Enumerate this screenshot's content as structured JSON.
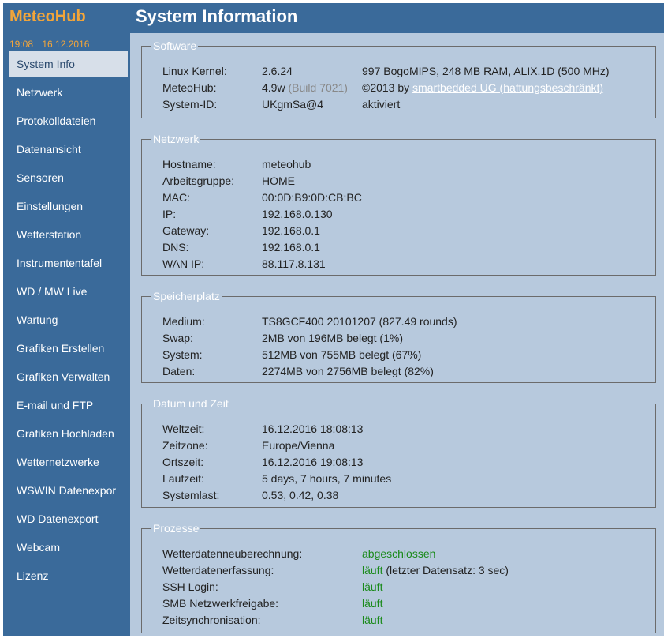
{
  "app": {
    "logo": "MeteoHub",
    "time": "19:08",
    "date": "16.12.2016"
  },
  "nav": [
    {
      "label": "System Info",
      "active": true
    },
    {
      "label": "Netzwerk"
    },
    {
      "label": "Protokolldateien"
    },
    {
      "label": "Datenansicht"
    },
    {
      "label": "Sensoren"
    },
    {
      "label": "Einstellungen"
    },
    {
      "label": "Wetterstation"
    },
    {
      "label": "Instrumententafel"
    },
    {
      "label": "WD / MW Live"
    },
    {
      "label": "Wartung"
    },
    {
      "label": "Grafiken Erstellen"
    },
    {
      "label": "Grafiken Verwalten"
    },
    {
      "label": "E-mail und FTP"
    },
    {
      "label": "Grafiken Hochladen"
    },
    {
      "label": "Wetternetzwerke"
    },
    {
      "label": "WSWIN Datenexpor"
    },
    {
      "label": "WD Datenexport"
    },
    {
      "label": "Webcam"
    },
    {
      "label": "Lizenz"
    }
  ],
  "page_title": "System Information",
  "software": {
    "legend": "Software",
    "kernel_label": "Linux Kernel:",
    "kernel_value": "2.6.24",
    "kernel_info": "997 BogoMIPS, 248 MB RAM, ALIX.1D (500 MHz)",
    "meteohub_label": "MeteoHub:",
    "meteohub_version": "4.9w",
    "meteohub_build": "(Build 7021)",
    "copyright_prefix": "©2013 by",
    "copyright_link": "smartbedded UG (haftungsbeschränkt)",
    "sysid_label": "System-ID:",
    "sysid_value": "UKgmSa@4",
    "sysid_status": "aktiviert"
  },
  "network": {
    "legend": "Netzwerk",
    "rows": [
      {
        "label": "Hostname:",
        "value": "meteohub"
      },
      {
        "label": "Arbeitsgruppe:",
        "value": "HOME"
      },
      {
        "label": "MAC:",
        "value": "00:0D:B9:0D:CB:BC"
      },
      {
        "label": "IP:",
        "value": "192.168.0.130"
      },
      {
        "label": "Gateway:",
        "value": "192.168.0.1"
      },
      {
        "label": "DNS:",
        "value": "192.168.0.1"
      },
      {
        "label": "WAN IP:",
        "value": "88.117.8.131"
      }
    ]
  },
  "storage": {
    "legend": "Speicherplatz",
    "rows": [
      {
        "label": "Medium:",
        "value": "TS8GCF400 20101207 (827.49 rounds)"
      },
      {
        "label": "Swap:",
        "value": "2MB von 196MB belegt (1%)"
      },
      {
        "label": "System:",
        "value": "512MB von 755MB belegt (67%)"
      },
      {
        "label": "Daten:",
        "value": "2274MB von 2756MB belegt (82%)"
      }
    ]
  },
  "datetime": {
    "legend": "Datum und Zeit",
    "rows": [
      {
        "label": "Weltzeit:",
        "value": "16.12.2016 18:08:13"
      },
      {
        "label": "Zeitzone:",
        "value": "Europe/Vienna"
      },
      {
        "label": "Ortszeit:",
        "value": "16.12.2016 19:08:13"
      },
      {
        "label": "Laufzeit:",
        "value": "5 days, 7 hours, 7 minutes"
      },
      {
        "label": "Systemlast:",
        "value": "0.53, 0.42, 0.38"
      }
    ]
  },
  "processes": {
    "legend": "Prozesse",
    "rows": [
      {
        "label": "Wetterdatenneuberechnung:",
        "status": "abgeschlossen",
        "extra": ""
      },
      {
        "label": "Wetterdatenerfassung:",
        "status": "läuft",
        "extra": "(letzter Datensatz: 3 sec)"
      },
      {
        "label": "SSH Login:",
        "status": "läuft",
        "extra": ""
      },
      {
        "label": "SMB Netzwerkfreigabe:",
        "status": "läuft",
        "extra": ""
      },
      {
        "label": "Zeitsynchronisation:",
        "status": "läuft",
        "extra": ""
      }
    ]
  },
  "colors": {
    "frame": "#3a6a9a",
    "content": "#b7c9dd",
    "accent": "#f2a53a",
    "ok": "#1a8a1a"
  }
}
